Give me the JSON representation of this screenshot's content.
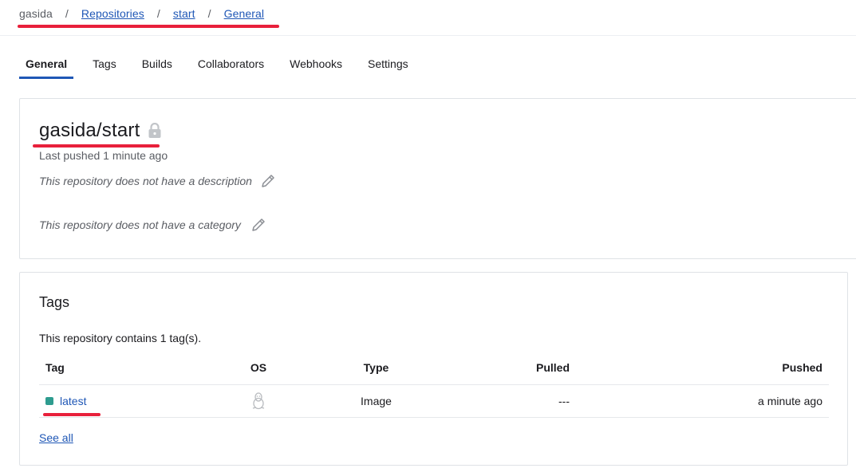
{
  "breadcrumb": {
    "home": "gasida",
    "separator": "/",
    "items": [
      "Repositories",
      "start",
      "General"
    ]
  },
  "tabs": [
    "General",
    "Tags",
    "Builds",
    "Collaborators",
    "Webhooks",
    "Settings"
  ],
  "active_tab": "General",
  "repo": {
    "name": "gasida/start",
    "last_pushed": "Last pushed 1 minute ago",
    "description": "This repository does not have a description",
    "category": "This repository does not have a category"
  },
  "tags_card": {
    "title": "Tags",
    "count_text": "This repository contains 1 tag(s).",
    "columns": [
      "Tag",
      "OS",
      "Type",
      "Pulled",
      "Pushed"
    ],
    "rows": [
      {
        "tag": "latest",
        "os_icon": "linux-tux-icon",
        "type": "Image",
        "pulled": "---",
        "pushed": "a minute ago"
      }
    ],
    "see_all": "See all"
  },
  "colors": {
    "link": "#1f57b6",
    "annotation": "#e8203b",
    "status_dot": "#2e9c8f"
  }
}
